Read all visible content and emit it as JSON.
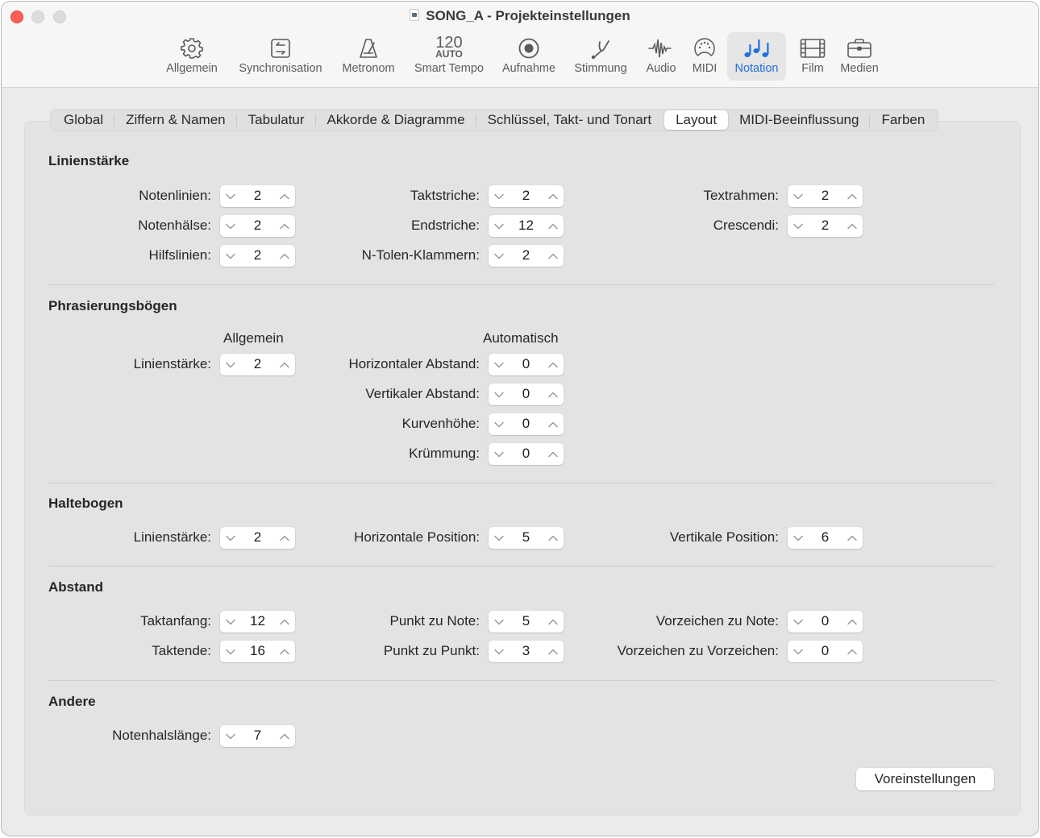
{
  "window": {
    "title": "SONG_A - Projekteinstellungen",
    "title_icon": "document-icon"
  },
  "toolbar": {
    "items": [
      {
        "label": "Allgemein",
        "icon": "gear-icon",
        "active": false
      },
      {
        "label": "Synchronisation",
        "icon": "sync-icon",
        "active": false
      },
      {
        "label": "Metronom",
        "icon": "metronome-icon",
        "active": false
      },
      {
        "label": "Smart Tempo",
        "icon": "tempo-icon",
        "tempo_value": "120",
        "tempo_mode": "AUTO",
        "active": false
      },
      {
        "label": "Aufnahme",
        "icon": "record-icon",
        "active": false
      },
      {
        "label": "Stimmung",
        "icon": "tuning-fork-icon",
        "active": false
      },
      {
        "label": "Audio",
        "icon": "waveform-icon",
        "active": false
      },
      {
        "label": "MIDI",
        "icon": "midi-port-icon",
        "active": false
      },
      {
        "label": "Notation",
        "icon": "notes-icon",
        "active": true
      },
      {
        "label": "Film",
        "icon": "film-icon",
        "active": false
      },
      {
        "label": "Medien",
        "icon": "briefcase-icon",
        "active": false
      }
    ],
    "accent_color": "#1f6fe0"
  },
  "tabs": [
    {
      "label": "Global",
      "active": false
    },
    {
      "label": "Ziffern & Namen",
      "active": false
    },
    {
      "label": "Tabulatur",
      "active": false
    },
    {
      "label": "Akkorde & Diagramme",
      "active": false
    },
    {
      "label": "Schlüssel, Takt- und Tonart",
      "active": false
    },
    {
      "label": "Layout",
      "active": true
    },
    {
      "label": "MIDI-Beeinflussung",
      "active": false
    },
    {
      "label": "Farben",
      "active": false
    }
  ],
  "sections": {
    "linienstaerke": {
      "title": "Linienstärke",
      "fields": [
        {
          "label": "Notenlinien:",
          "value": "2"
        },
        {
          "label": "Notenhälse:",
          "value": "2"
        },
        {
          "label": "Hilfslinien:",
          "value": "2"
        },
        {
          "label": "Taktstriche:",
          "value": "2"
        },
        {
          "label": "Endstriche:",
          "value": "12"
        },
        {
          "label": "N-Tolen-Klammern:",
          "value": "2"
        },
        {
          "label": "Textrahmen:",
          "value": "2"
        },
        {
          "label": "Crescendi:",
          "value": "2"
        }
      ]
    },
    "phrasierung": {
      "title": "Phrasierungsbögen",
      "col_general": "Allgemein",
      "col_auto": "Automatisch",
      "fields": [
        {
          "label": "Linienstärke:",
          "value": "2"
        },
        {
          "label": "Horizontaler Abstand:",
          "value": "0"
        },
        {
          "label": "Vertikaler Abstand:",
          "value": "0"
        },
        {
          "label": "Kurvenhöhe:",
          "value": "0"
        },
        {
          "label": "Krümmung:",
          "value": "0"
        }
      ]
    },
    "haltebogen": {
      "title": "Haltebogen",
      "fields": [
        {
          "label": "Linienstärke:",
          "value": "2"
        },
        {
          "label": "Horizontale Position:",
          "value": "5"
        },
        {
          "label": "Vertikale Position:",
          "value": "6"
        }
      ]
    },
    "abstand": {
      "title": "Abstand",
      "fields": [
        {
          "label": "Taktanfang:",
          "value": "12"
        },
        {
          "label": "Taktende:",
          "value": "16"
        },
        {
          "label": "Punkt zu Note:",
          "value": "5"
        },
        {
          "label": "Punkt zu Punkt:",
          "value": "3"
        },
        {
          "label": "Vorzeichen zu Note:",
          "value": "0"
        },
        {
          "label": "Vorzeichen zu Vorzeichen:",
          "value": "0"
        }
      ]
    },
    "andere": {
      "title": "Andere",
      "fields": [
        {
          "label": "Notenhalslänge:",
          "value": "7"
        }
      ]
    }
  },
  "footer": {
    "preset_button": "Voreinstellungen"
  }
}
